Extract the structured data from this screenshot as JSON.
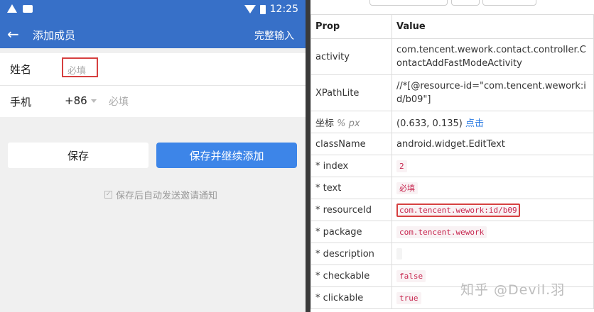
{
  "phone": {
    "status": {
      "time": "12:25",
      "icons": [
        "warning-icon",
        "image-icon",
        "wifi-icon",
        "battery-icon"
      ]
    },
    "appbar": {
      "back_icon": "arrow-left-icon",
      "title": "添加成员",
      "finish": "完整输入"
    },
    "form": {
      "name_label": "姓名",
      "name_placeholder": "必填",
      "mobile_label": "手机",
      "country_code": "+86",
      "mobile_placeholder": "必填"
    },
    "buttons": {
      "save": "保存",
      "save_continue": "保存并继续添加"
    },
    "notice": {
      "checked": true,
      "text": "保存后自动发送邀请通知"
    },
    "colors": {
      "primary": "#3770c8",
      "button_blue": "#3d85e8",
      "highlight_red": "#d64040"
    }
  },
  "inspector": {
    "headers": {
      "prop": "Prop",
      "value": "Value"
    },
    "rows": {
      "activity": {
        "prop": "activity",
        "value": "com.tencent.wework.contact.controller.ContactAddFastModeActivity"
      },
      "xpath": {
        "prop": "XPathLite",
        "value": "//*[@resource-id=\"com.tencent.wework:id/b09\"]"
      },
      "coord": {
        "prop": "坐标",
        "unit_pct": "%",
        "unit_px": "px",
        "value": "(0.633, 0.135)",
        "link": "点击"
      },
      "classname": {
        "prop": "className",
        "value": "android.widget.EditText"
      },
      "index": {
        "prop": "* index",
        "value": "2"
      },
      "text": {
        "prop": "* text",
        "value": "必填"
      },
      "resourceid": {
        "prop": "* resourceId",
        "value": "com.tencent.wework:id/b09"
      },
      "package": {
        "prop": "* package",
        "value": "com.tencent.wework"
      },
      "description": {
        "prop": "* description",
        "value": ""
      },
      "checkable": {
        "prop": "* checkable",
        "value": "false"
      },
      "clickable": {
        "prop": "* clickable",
        "value": "true"
      }
    },
    "watermark": "知乎 @Devil.羽"
  }
}
